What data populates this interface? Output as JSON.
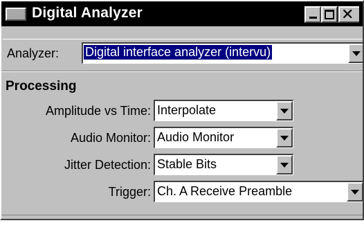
{
  "window": {
    "title": "Digital Analyzer",
    "close_glyph": "✕"
  },
  "analyzer": {
    "label": "Analyzer:",
    "value": "Digital interface analyzer (intervu)"
  },
  "processing": {
    "title": "Processing",
    "rows": [
      {
        "label": "Amplitude vs Time:",
        "value": "Interpolate"
      },
      {
        "label": "Audio Monitor:",
        "value": "Audio Monitor"
      },
      {
        "label": "Jitter Detection:",
        "value": "Stable Bits"
      },
      {
        "label": "Trigger:",
        "value": "Ch. A Receive Preamble"
      }
    ]
  },
  "icons": {
    "app": "window-icon",
    "minimize": "minimize-icon",
    "maximize": "maximize-icon",
    "close": "close-icon",
    "dropdown": "chevron-down-icon"
  },
  "colors": {
    "titlebar": "#000000",
    "face": "#c0c0c0",
    "selection": "#000080"
  }
}
